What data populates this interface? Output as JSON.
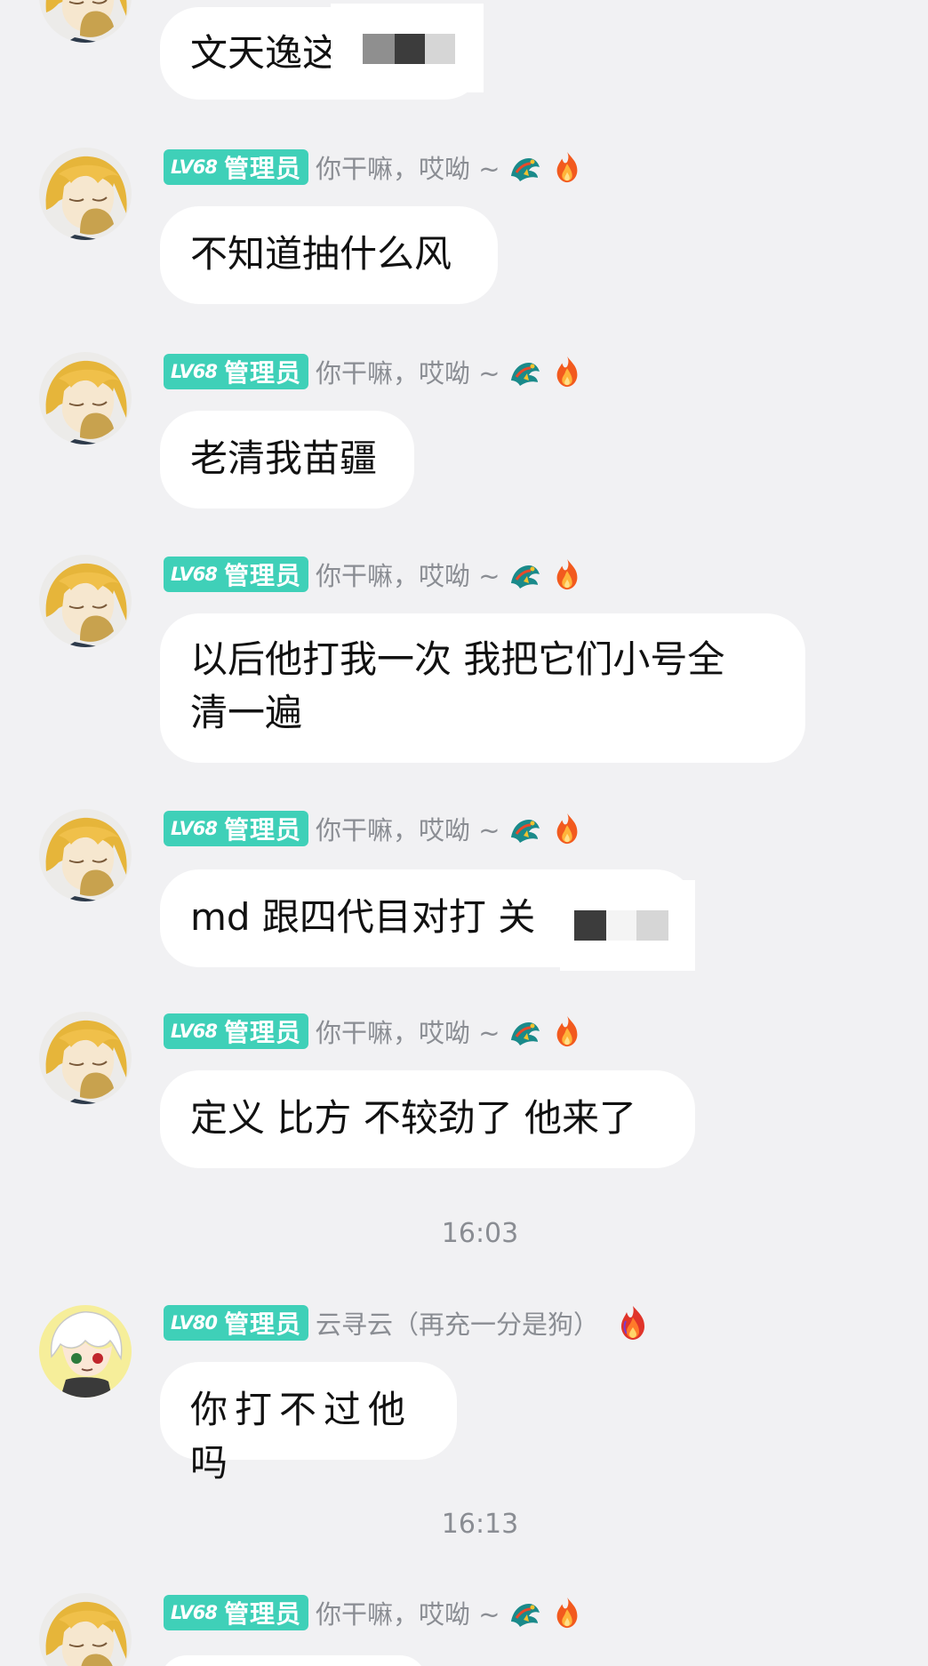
{
  "colors": {
    "background": "#f1f1f3",
    "badge": "#3fd0b8",
    "bubble": "#ffffff",
    "meta_text": "#8a8d93"
  },
  "messages": [
    {
      "role": "",
      "level": "",
      "nickname": "",
      "text": "文天逸这",
      "avatar": "blonde-anime-avatar",
      "obscured": true
    },
    {
      "level": "LV68",
      "role": "管理员",
      "nickname": "你干嘛，哎呦 ~",
      "text": "不知道抽什么风",
      "avatar": "blonde-anime-avatar"
    },
    {
      "level": "LV68",
      "role": "管理员",
      "nickname": "你干嘛，哎呦 ~",
      "text": "老清我苗疆",
      "avatar": "blonde-anime-avatar"
    },
    {
      "level": "LV68",
      "role": "管理员",
      "nickname": "你干嘛，哎呦 ~",
      "text_line1": "以后他打我一次 我把它们小号全",
      "text_line2": "清一遍",
      "avatar": "blonde-anime-avatar"
    },
    {
      "level": "LV68",
      "role": "管理员",
      "nickname": "你干嘛，哎呦 ~",
      "text": "md 跟四代目对打 关",
      "avatar": "blonde-anime-avatar",
      "obscured": true
    },
    {
      "level": "LV68",
      "role": "管理员",
      "nickname": "你干嘛，哎呦 ~",
      "text": "定义 比方 不较劲了 他来了",
      "avatar": "blonde-anime-avatar"
    },
    {
      "level": "LV80",
      "role": "管理员",
      "nickname": "云寻云（再充一分是狗）",
      "text": "你打不过他吗",
      "avatar": "white-hair-chibi-avatar"
    },
    {
      "level": "LV68",
      "role": "管理员",
      "nickname": "你干嘛，哎呦 ~",
      "avatar": "blonde-anime-avatar"
    }
  ],
  "timestamps": [
    "16:03",
    "16:13"
  ],
  "icons": [
    "dragon-badge-icon",
    "fire-icon",
    "flame-icon"
  ]
}
